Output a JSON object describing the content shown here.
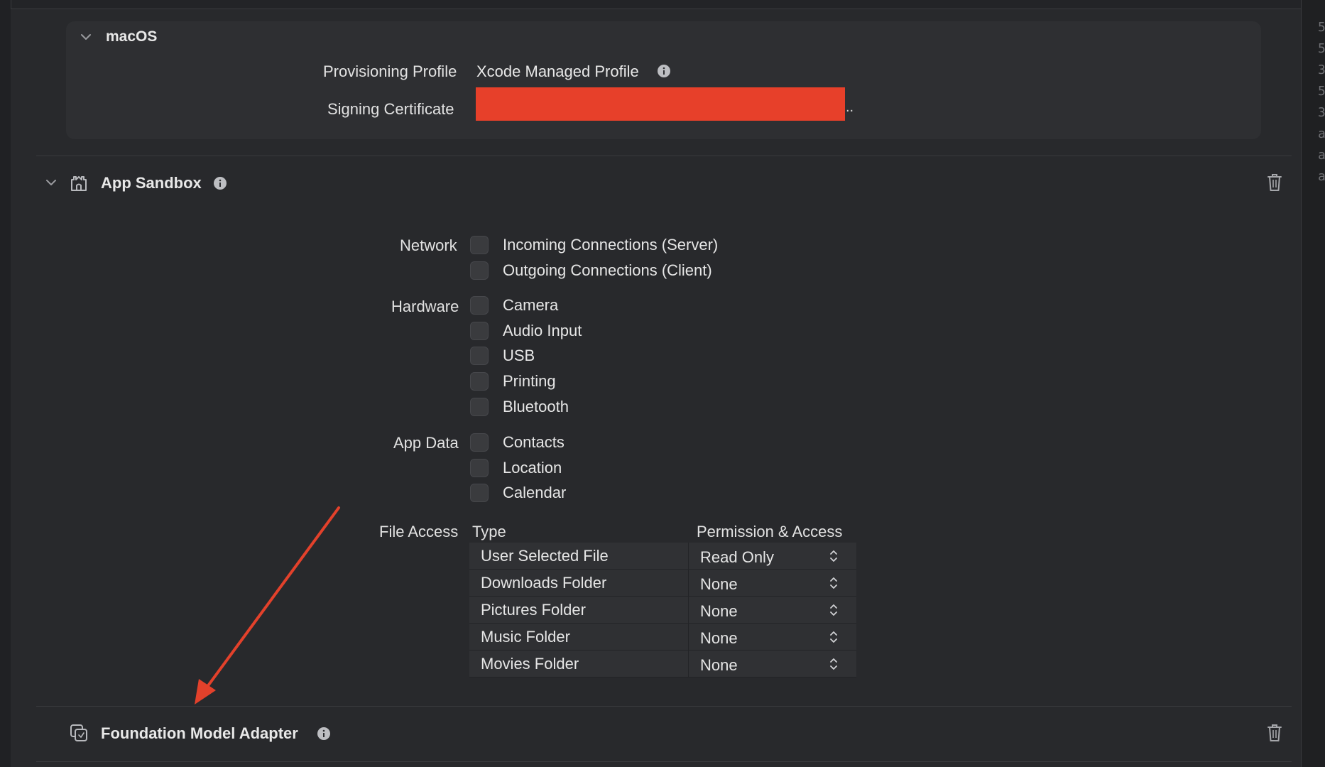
{
  "scroll_margin_text": "5\n5\n3\n5\n3\na\na\na",
  "macos": {
    "title": "macOS",
    "provisioning_label": "Provisioning Profile",
    "provisioning_value": "Xcode Managed Profile",
    "signing_label": "Signing Certificate",
    "signing_ellipsis": ".."
  },
  "app_sandbox": {
    "title": "App Sandbox",
    "network_label": "Network",
    "network_items": [
      "Incoming Connections (Server)",
      "Outgoing Connections (Client)"
    ],
    "hardware_label": "Hardware",
    "hardware_items": [
      "Camera",
      "Audio Input",
      "USB",
      "Printing",
      "Bluetooth"
    ],
    "app_data_label": "App Data",
    "app_data_items": [
      "Contacts",
      "Location",
      "Calendar"
    ],
    "file_access_label": "File Access",
    "file_access_columns": [
      "Type",
      "Permission & Access"
    ],
    "file_access_rows": [
      {
        "type": "User Selected File",
        "permission": "Read Only"
      },
      {
        "type": "Downloads Folder",
        "permission": "None"
      },
      {
        "type": "Pictures Folder",
        "permission": "None"
      },
      {
        "type": "Music Folder",
        "permission": "None"
      },
      {
        "type": "Movies Folder",
        "permission": "None"
      }
    ]
  },
  "foundation_model": {
    "title": "Foundation Model Adapter"
  },
  "colors": {
    "redaction": "#e7402a",
    "annotation_arrow": "#e3412b",
    "background": "#28292c"
  },
  "icons": {
    "collapse": "chevron-down-icon",
    "info": "info-circle-icon",
    "sandbox": "sandbox-castle-icon",
    "adapter": "adapter-layers-icon",
    "trash": "trash-icon",
    "stepper": "up-down-chevron-icon"
  }
}
